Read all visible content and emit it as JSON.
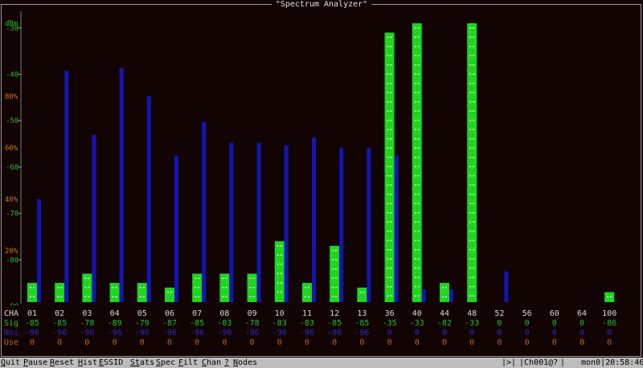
{
  "window": {
    "title": "\"Spectrum Analyzer\""
  },
  "colors": {
    "sig_bar": "#20d520",
    "noise_bar": "#1414b4",
    "axis_dbm": "#20c020",
    "axis_pct": "#c87820",
    "rows_noise": "#2828c8",
    "rows_use": "#b86818"
  },
  "axis_left": {
    "dbm_unit": "dBm",
    "dbm_ticks": [
      "-30",
      "-40",
      "-50",
      "-60",
      "-70",
      "-80",
      "-90"
    ],
    "pct_ticks": [
      "80%",
      "60%",
      "40%",
      "20%"
    ]
  },
  "table": {
    "row_labels": {
      "cha": "CHA",
      "sig": "Sig",
      "noise": "Noi",
      "use": "Use"
    },
    "channels": [
      "01",
      "02",
      "03",
      "04",
      "05",
      "06",
      "07",
      "08",
      "09",
      "10",
      "11",
      "12",
      "13",
      "36",
      "40",
      "44",
      "48",
      "52",
      "56",
      "60",
      "64",
      "100"
    ],
    "sig": [
      "-85",
      "-85",
      "-78",
      "-89",
      "-79",
      "-87",
      "-85",
      "-83",
      "-78",
      "-83",
      "-83",
      "-85",
      "-85",
      "-35",
      "-33",
      "-82",
      "-33",
      "0",
      "0",
      "0",
      "0",
      "-86"
    ],
    "noise": [
      "-96",
      "-96",
      "-96",
      "-96",
      "-96",
      "-96",
      "-96",
      "-96",
      "-96",
      "-96",
      "-96",
      "-96",
      "-96",
      "0",
      "0",
      "0",
      "0",
      "0",
      "0",
      "0",
      "0",
      "0"
    ],
    "use": [
      "0",
      "0",
      "0",
      "0",
      "0",
      "0",
      "0",
      "0",
      "0",
      "0",
      "0",
      "0",
      "0",
      "0",
      "0",
      "0",
      "0",
      "0",
      "0",
      "0",
      "0",
      "0"
    ]
  },
  "chart_data": {
    "type": "bar",
    "ylabel": "dBm",
    "ylim": [
      -100,
      -29
    ],
    "categories": [
      "01",
      "02",
      "03",
      "04",
      "05",
      "06",
      "07",
      "08",
      "09",
      "10",
      "11",
      "12",
      "13",
      "36",
      "40",
      "44",
      "48",
      "52",
      "56",
      "60",
      "64",
      "100"
    ],
    "series": [
      {
        "values": [
          -85,
          -85,
          -83,
          -85,
          -85,
          -86,
          -83,
          -83,
          -83,
          -76,
          -85,
          -77,
          -86,
          -31,
          -29,
          -85,
          -29,
          null,
          null,
          null,
          null,
          -87
        ]
      },
      {
        "values": [
          40,
          90,
          65,
          91,
          80,
          57,
          70,
          62,
          62,
          61,
          64,
          60,
          60,
          57,
          5,
          5,
          0,
          12,
          0,
          0,
          0,
          0
        ]
      }
    ]
  },
  "menubar": {
    "items": [
      {
        "key": "Q",
        "rest": "uit"
      },
      {
        "key": "P",
        "rest": "ause"
      },
      {
        "key": "R",
        "rest": "eset"
      },
      {
        "key": "H",
        "rest": "ist"
      },
      {
        "key": "E",
        "rest": "SSID"
      },
      {
        "key": "St",
        "rest": "ats"
      },
      {
        "key": "S",
        "rest": "pec"
      },
      {
        "key": "F",
        "rest": "ilt"
      },
      {
        "key": "C",
        "rest": "han"
      },
      {
        "key": "?",
        "rest": ""
      },
      {
        "key": "N",
        "rest": "odes"
      }
    ],
    "status": [
      "|>|",
      "|Ch001@?",
      "|",
      "mon0|20:58:46"
    ]
  }
}
